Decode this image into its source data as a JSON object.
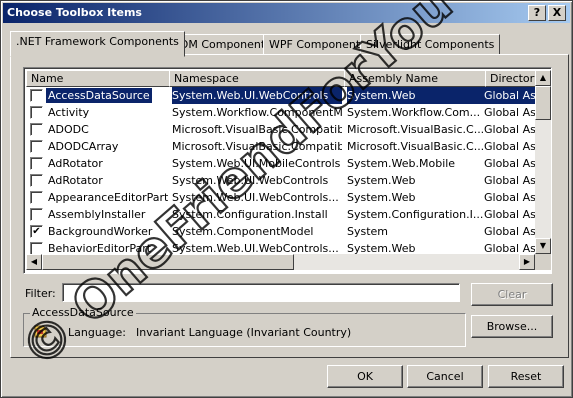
{
  "window": {
    "title": "Choose Toolbox Items"
  },
  "titlebar_buttons": {
    "help": "?",
    "close": "X"
  },
  "tabs": [
    {
      "label": ".NET Framework Components",
      "active": true
    },
    {
      "label": "COM Components",
      "active": false
    },
    {
      "label": "WPF Components",
      "active": false
    },
    {
      "label": "Silverlight Components",
      "active": false
    }
  ],
  "list": {
    "columns": [
      "Name",
      "Namespace",
      "Assembly Name",
      "Directory"
    ],
    "rows": [
      {
        "name": "AccessDataSource",
        "namespace": "System.Web.UI.WebControls",
        "assembly": "System.Web",
        "directory": "Global Ass",
        "checked": false,
        "selected": true
      },
      {
        "name": "Activity",
        "namespace": "System.Workflow.ComponentM...",
        "assembly": "System.Workflow.Com...",
        "directory": "Global Ass",
        "checked": false,
        "selected": false
      },
      {
        "name": "ADODC",
        "namespace": "Microsoft.VisualBasic.Compatibi...",
        "assembly": "Microsoft.VisualBasic.C...",
        "directory": "Global Ass",
        "checked": false,
        "selected": false
      },
      {
        "name": "ADODCArray",
        "namespace": "Microsoft.VisualBasic.Compatibi...",
        "assembly": "Microsoft.VisualBasic.C...",
        "directory": "Global Ass",
        "checked": false,
        "selected": false
      },
      {
        "name": "AdRotator",
        "namespace": "System.Web.UI.MobileControls",
        "assembly": "System.Web.Mobile",
        "directory": "Global Ass",
        "checked": false,
        "selected": false
      },
      {
        "name": "AdRotator",
        "namespace": "System.Web.UI.WebControls",
        "assembly": "System.Web",
        "directory": "Global Ass",
        "checked": false,
        "selected": false
      },
      {
        "name": "AppearanceEditorPart",
        "namespace": "System.Web.UI.WebControls...",
        "assembly": "System.Web",
        "directory": "Global Ass",
        "checked": false,
        "selected": false
      },
      {
        "name": "AssemblyInstaller",
        "namespace": "System.Configuration.Install",
        "assembly": "System.Configuration.I...",
        "directory": "Global Ass",
        "checked": false,
        "selected": false
      },
      {
        "name": "BackgroundWorker",
        "namespace": "System.ComponentModel",
        "assembly": "System",
        "directory": "Global Ass",
        "checked": true,
        "selected": false
      },
      {
        "name": "BehaviorEditorPart",
        "namespace": "System.Web.UI.WebControls...",
        "assembly": "System.Web",
        "directory": "Global Ass",
        "checked": false,
        "selected": false
      }
    ]
  },
  "filter": {
    "label": "Filter:",
    "value": "",
    "clear_label": "Clear"
  },
  "details": {
    "group_label": "AccessDataSource",
    "language_label": "Language:",
    "language_value": "Invariant Language (Invariant Country)",
    "browse_label": "Browse..."
  },
  "footer": {
    "ok_label": "OK",
    "cancel_label": "Cancel",
    "reset_label": "Reset"
  },
  "watermark": {
    "text": "© OneFriendForYou"
  }
}
